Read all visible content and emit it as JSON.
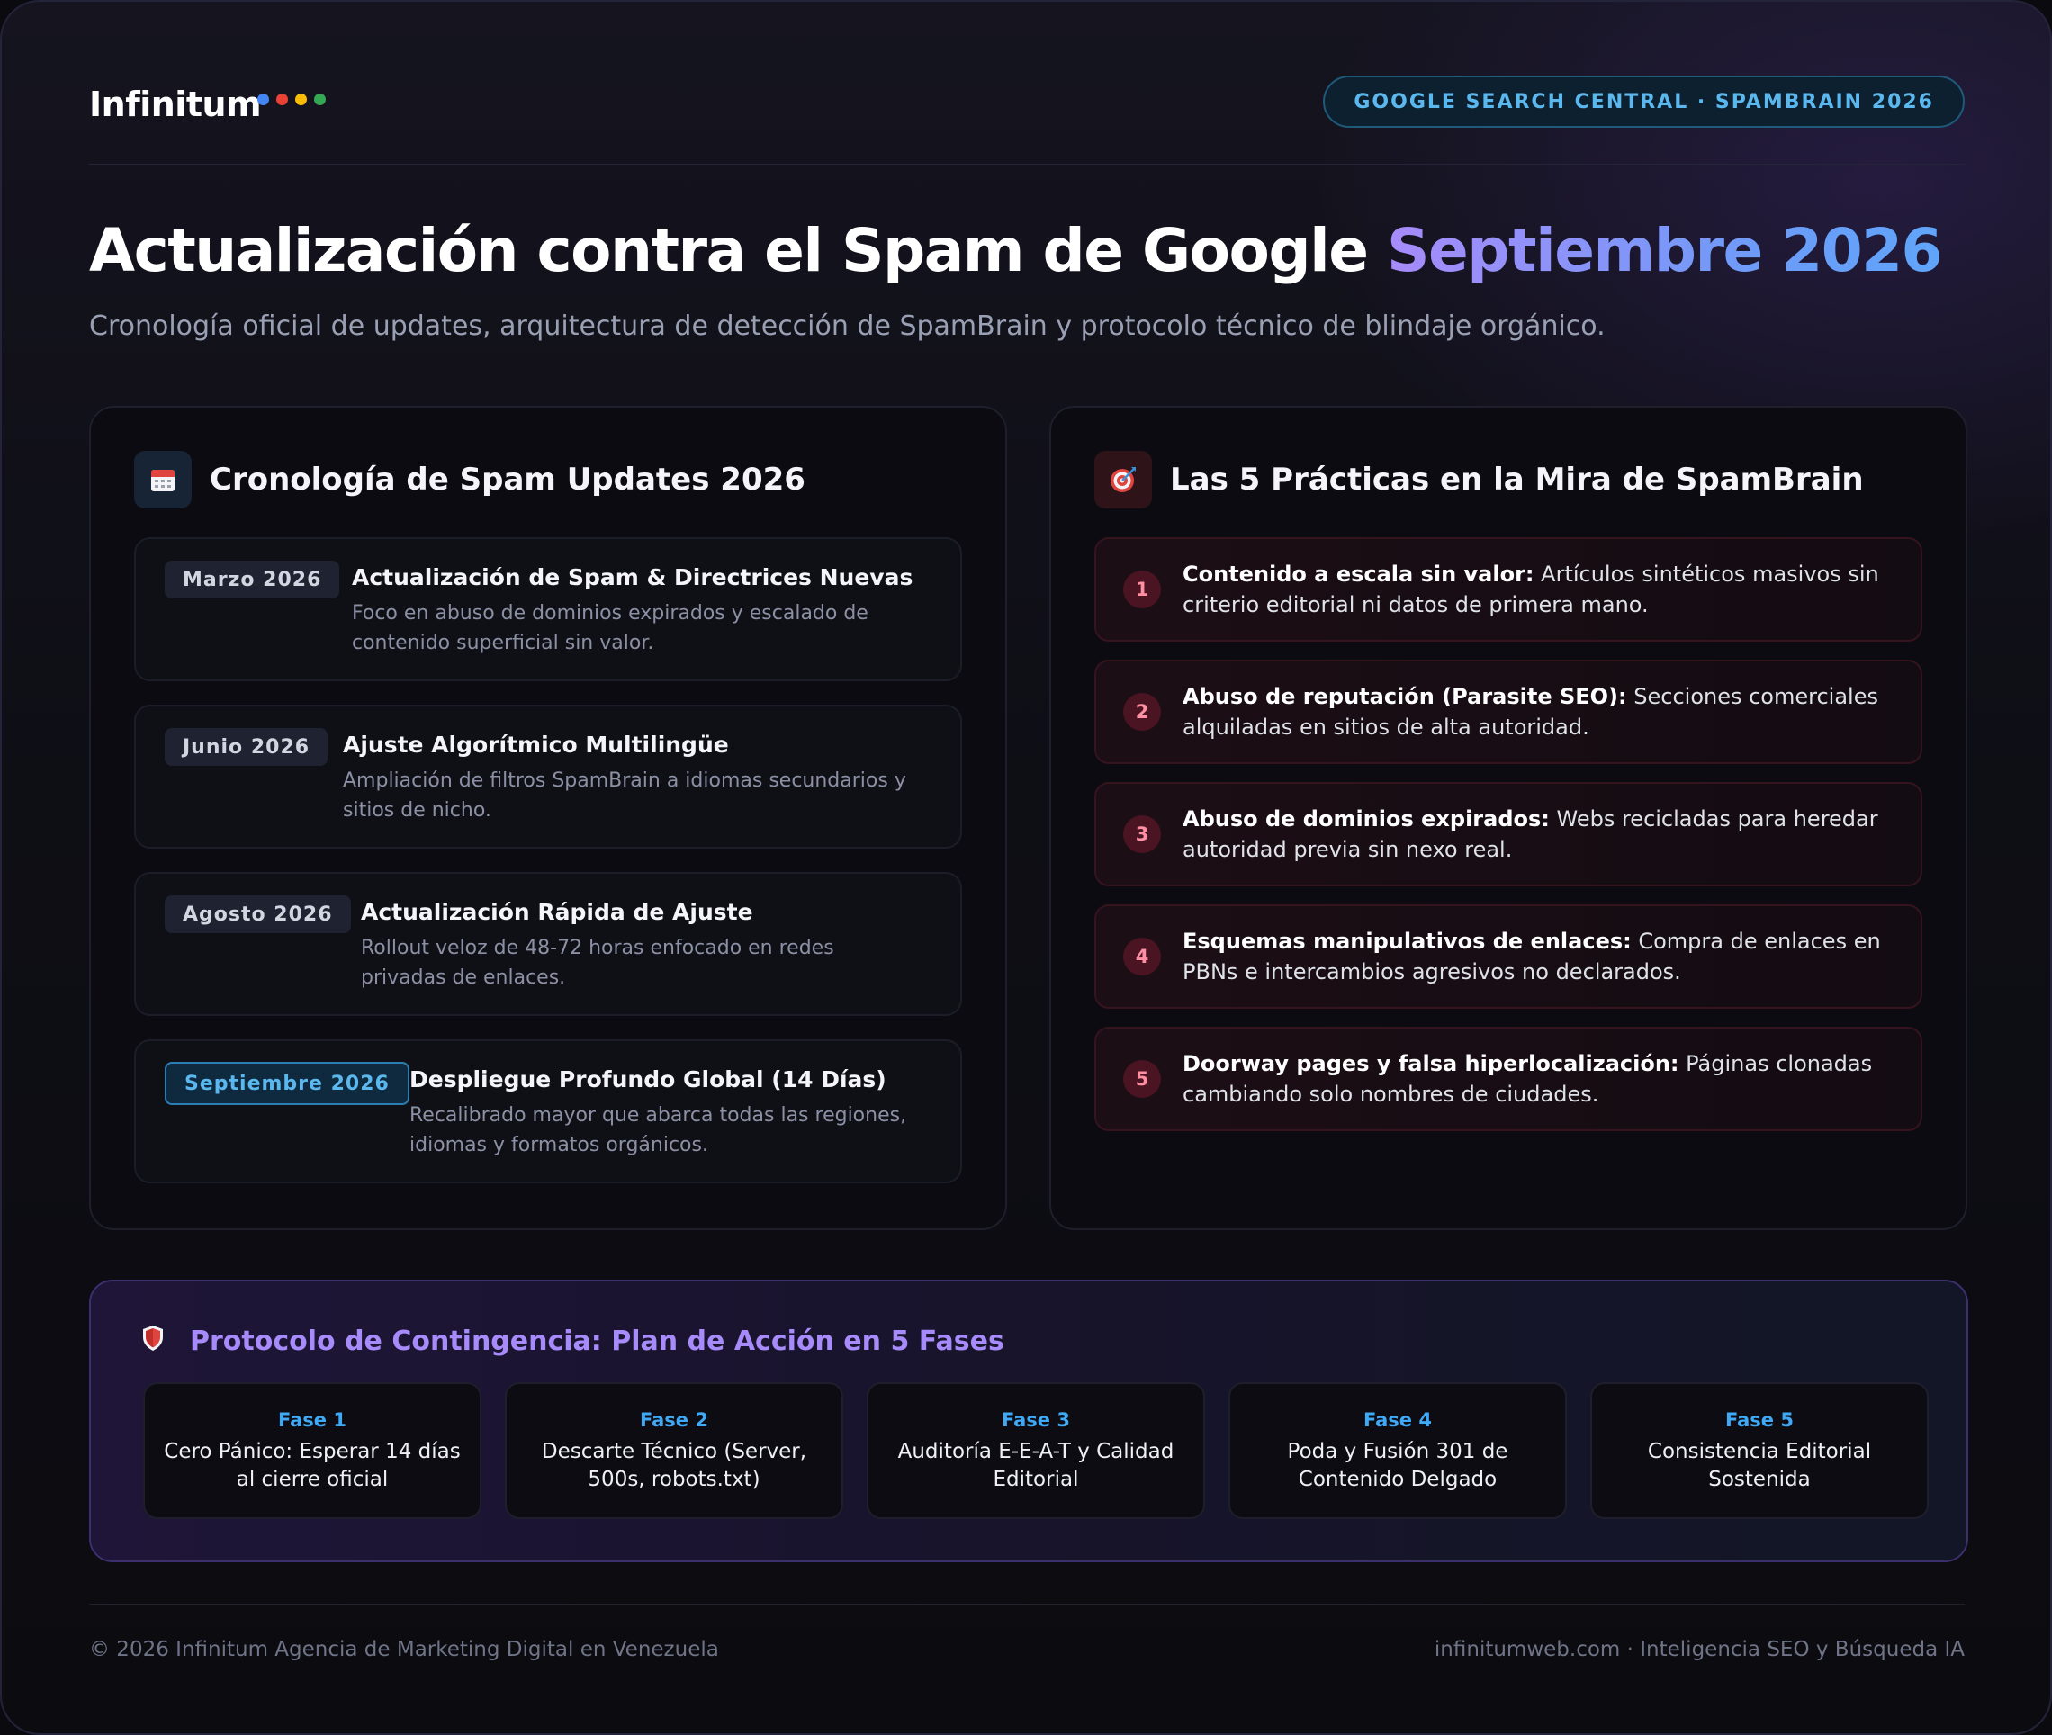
{
  "brand": {
    "logo": "Infinitum",
    "dots": [
      "#4285f4",
      "#ea4335",
      "#fbbc05",
      "#34a853"
    ]
  },
  "badge": "GOOGLE SEARCH CENTRAL · SPAMBRAIN 2026",
  "hero": {
    "title_main": "Actualización contra el Spam de Google",
    "title_accent": "Septiembre 2026",
    "subtitle": "Cronología oficial de updates, arquitectura de detección de SpamBrain y protocolo técnico de blindaje orgánico."
  },
  "timeline": {
    "icon": "calendar-icon",
    "title": "Cronología de Spam Updates 2026",
    "items": [
      {
        "date": "Marzo 2026",
        "heading": "Actualización de Spam & Directrices Nuevas",
        "desc": "Foco en abuso de dominios expirados y escalado de contenido superficial sin valor."
      },
      {
        "date": "Junio 2026",
        "heading": "Ajuste Algorítmico Multilingüe",
        "desc": "Ampliación de filtros SpamBrain a idiomas secundarios y sitios de nicho."
      },
      {
        "date": "Agosto 2026",
        "heading": "Actualización Rápida de Ajuste",
        "desc": "Rollout veloz de 48-72 horas enfocado en redes privadas de enlaces."
      },
      {
        "date": "Septiembre 2026",
        "heading": "Despliegue Profundo Global (14 Días)",
        "desc": "Recalibrado mayor que abarca todas las regiones, idiomas y formatos orgánicos."
      }
    ]
  },
  "practices": {
    "icon": "target-icon",
    "title": "Las 5 Prácticas en la Mira de SpamBrain",
    "items": [
      {
        "num": "1",
        "bold": "Contenido a escala sin valor:",
        "text": " Artículos sintéticos masivos sin criterio editorial ni datos de primera mano."
      },
      {
        "num": "2",
        "bold": "Abuso de reputación (Parasite SEO):",
        "text": " Secciones comerciales alquiladas en sitios de alta autoridad."
      },
      {
        "num": "3",
        "bold": "Abuso de dominios expirados:",
        "text": " Webs recicladas para heredar autoridad previa sin nexo real."
      },
      {
        "num": "4",
        "bold": "Esquemas manipulativos de enlaces:",
        "text": " Compra de enlaces en PBNs e intercambios agresivos no declarados."
      },
      {
        "num": "5",
        "bold": "Doorway pages y falsa hiperlocalización:",
        "text": " Páginas clonadas cambiando solo nombres de ciudades."
      }
    ]
  },
  "protocol": {
    "icon": "shield-icon",
    "title": "Protocolo de Contingencia: Plan de Acción en 5 Fases",
    "phases": [
      {
        "label": "Fase 1",
        "text": "Cero Pánico: Esperar 14 días al cierre oficial"
      },
      {
        "label": "Fase 2",
        "text": "Descarte Técnico (Server, 500s, robots.txt)"
      },
      {
        "label": "Fase 3",
        "text": "Auditoría E-E-A-T y Calidad Editorial"
      },
      {
        "label": "Fase 4",
        "text": "Poda y Fusión 301 de Contenido Delgado"
      },
      {
        "label": "Fase 5",
        "text": "Consistencia Editorial Sostenida"
      }
    ]
  },
  "footer": {
    "left": "© 2026 Infinitum Agencia de Marketing Digital en Venezuela",
    "right": "infinitumweb.com · Inteligencia SEO y Búsqueda IA"
  }
}
